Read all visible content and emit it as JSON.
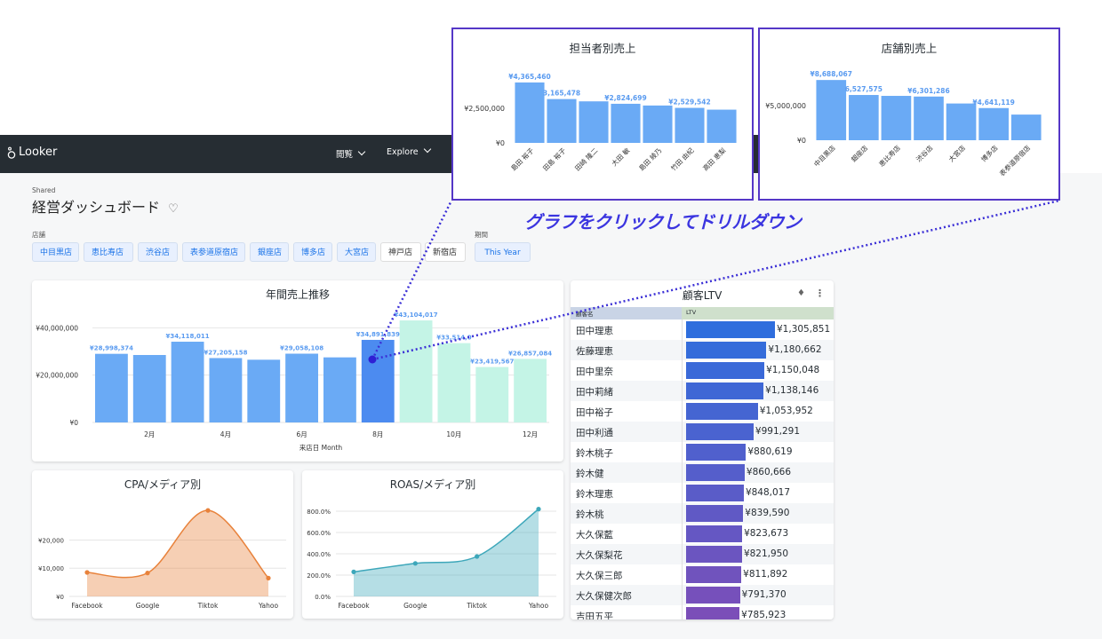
{
  "app": {
    "name": "Looker",
    "nav": [
      {
        "label": "閲覧"
      },
      {
        "label": "Explore"
      }
    ]
  },
  "dashboard": {
    "shared_label": "Shared",
    "title": "経営ダッシュボード",
    "filters": {
      "store_label": "店舗",
      "stores": [
        {
          "label": "中目黒店",
          "selected": true
        },
        {
          "label": "恵比寿店",
          "selected": true
        },
        {
          "label": "渋谷店",
          "selected": true
        },
        {
          "label": "表参道原宿店",
          "selected": true
        },
        {
          "label": "銀座店",
          "selected": true
        },
        {
          "label": "博多店",
          "selected": true
        },
        {
          "label": "大宮店",
          "selected": true
        },
        {
          "label": "神戸店",
          "selected": false
        },
        {
          "label": "新宿店",
          "selected": false
        }
      ],
      "period_label": "期間",
      "period_value": "This Year"
    }
  },
  "annual_sales": {
    "title": "年間売上推移",
    "xlabel": "来店日 Month",
    "highlight_color": "#4c8bf0",
    "chart_data": {
      "type": "bar",
      "x": [
        1,
        2,
        3,
        4,
        5,
        6,
        7,
        8,
        9,
        10,
        11,
        12
      ],
      "x_tick_labels": [
        "2月",
        "4月",
        "6月",
        "8月",
        "10月",
        "12月"
      ],
      "x_tick_values": [
        2,
        4,
        6,
        8,
        10,
        12
      ],
      "values": [
        28998374,
        28500000,
        34118011,
        27205158,
        26500000,
        29058108,
        27500000,
        34891839,
        43104017,
        33514000,
        23419567,
        26857084
      ],
      "data_labels": [
        "¥28,998,374",
        "",
        "¥34,118,011",
        "¥27,205,158",
        "",
        "¥29,058,108",
        "",
        "¥34,891,839",
        "¥43,104,017",
        "¥33,514,0",
        "¥23,419,567",
        "¥26,857,084"
      ],
      "bar_colors": [
        "#6aaaf5",
        "#6aaaf5",
        "#6aaaf5",
        "#6aaaf5",
        "#6aaaf5",
        "#6aaaf5",
        "#6aaaf5",
        "#4c8bf0",
        "#c4f4e6",
        "#c4f4e6",
        "#c4f4e6",
        "#c4f4e6"
      ],
      "yticks": [
        "¥0",
        "¥20,000,000",
        "¥40,000,000"
      ],
      "ytick_values": [
        0,
        20000000,
        40000000
      ],
      "ylim": [
        0,
        48000000
      ]
    }
  },
  "cpa": {
    "title": "CPA/メディア別",
    "chart_data": {
      "type": "area",
      "categories": [
        "Facebook",
        "Google",
        "Tiktok",
        "Yahoo"
      ],
      "values": [
        8500,
        8300,
        30500,
        6500
      ],
      "yticks": [
        "¥0",
        "¥10,000",
        "¥20,000"
      ],
      "ytick_values": [
        0,
        10000,
        20000
      ],
      "ylim": [
        0,
        34000
      ],
      "color": "#e8823b"
    }
  },
  "roas": {
    "title": "ROAS/メディア別",
    "chart_data": {
      "type": "area",
      "categories": [
        "Facebook",
        "Google",
        "Tiktok",
        "Yahoo"
      ],
      "values": [
        230,
        310,
        375,
        820
      ],
      "yticks": [
        "0.0%",
        "200.0%",
        "400.0%",
        "600.0%",
        "800.0%"
      ],
      "ytick_values": [
        0,
        200,
        400,
        600,
        800
      ],
      "ylim": [
        0,
        900
      ],
      "color": "#3da7ba"
    }
  },
  "ltv": {
    "title": "顧客LTV",
    "col_name": "顧客名",
    "col_ltv": "LTV",
    "chart_data": {
      "type": "table",
      "rows": [
        {
          "name": "田中理恵",
          "ltv": 1305851,
          "label": "¥1,305,851"
        },
        {
          "name": "佐藤理恵",
          "ltv": 1180662,
          "label": "¥1,180,662"
        },
        {
          "name": "田中里奈",
          "ltv": 1150048,
          "label": "¥1,150,048"
        },
        {
          "name": "田中莉緒",
          "ltv": 1138146,
          "label": "¥1,138,146"
        },
        {
          "name": "田中裕子",
          "ltv": 1053952,
          "label": "¥1,053,952"
        },
        {
          "name": "田中利通",
          "ltv": 991291,
          "label": "¥991,291"
        },
        {
          "name": "鈴木桃子",
          "ltv": 880619,
          "label": "¥880,619"
        },
        {
          "name": "鈴木健",
          "ltv": 860666,
          "label": "¥860,666"
        },
        {
          "name": "鈴木理恵",
          "ltv": 848017,
          "label": "¥848,017"
        },
        {
          "name": "鈴木桃",
          "ltv": 839590,
          "label": "¥839,590"
        },
        {
          "name": "大久保藍",
          "ltv": 823673,
          "label": "¥823,673"
        },
        {
          "name": "大久保梨花",
          "ltv": 821950,
          "label": "¥821,950"
        },
        {
          "name": "大久保三郎",
          "ltv": 811892,
          "label": "¥811,892"
        },
        {
          "name": "大久保健次郎",
          "ltv": 791370,
          "label": "¥791,370"
        },
        {
          "name": "吉田五平",
          "ltv": 785923,
          "label": "¥785,923"
        }
      ]
    }
  },
  "popup_staff": {
    "title": "担当者別売上",
    "chart_data": {
      "type": "bar",
      "categories": [
        "島田 裕子",
        "田島 裕子",
        "田崎 隆二",
        "大田 敏",
        "島田 綾乃",
        "竹田 由紀",
        "高田 恵梨"
      ],
      "values": [
        4365460,
        3165478,
        3000000,
        2824699,
        2700000,
        2529542,
        2400000
      ],
      "data_labels": [
        "¥4,365,460",
        "3,165,478",
        "",
        "¥2,824,699",
        "",
        "¥2,529,542",
        ""
      ],
      "yticks": [
        "¥0",
        "¥2,500,000"
      ],
      "ytick_values": [
        0,
        2500000
      ],
      "ylim": [
        0,
        5000000
      ]
    }
  },
  "popup_store": {
    "title": "店舗別売上",
    "chart_data": {
      "type": "bar",
      "categories": [
        "中目黒店",
        "銀座店",
        "恵比寿店",
        "渋谷店",
        "大宮店",
        "博多店",
        "表参道原宿店"
      ],
      "values": [
        8688067,
        6527575,
        6400000,
        6301286,
        5300000,
        4641119,
        3700000
      ],
      "data_labels": [
        "¥8,688,067",
        "6,527,575",
        "",
        "¥6,301,286",
        "",
        "¥4,641,119",
        ""
      ],
      "yticks": [
        "¥0",
        "¥5,000,000"
      ],
      "ytick_values": [
        0,
        5000000
      ],
      "ylim": [
        0,
        10500000
      ]
    }
  },
  "caption": "グラフをクリックしてドリルダウン"
}
